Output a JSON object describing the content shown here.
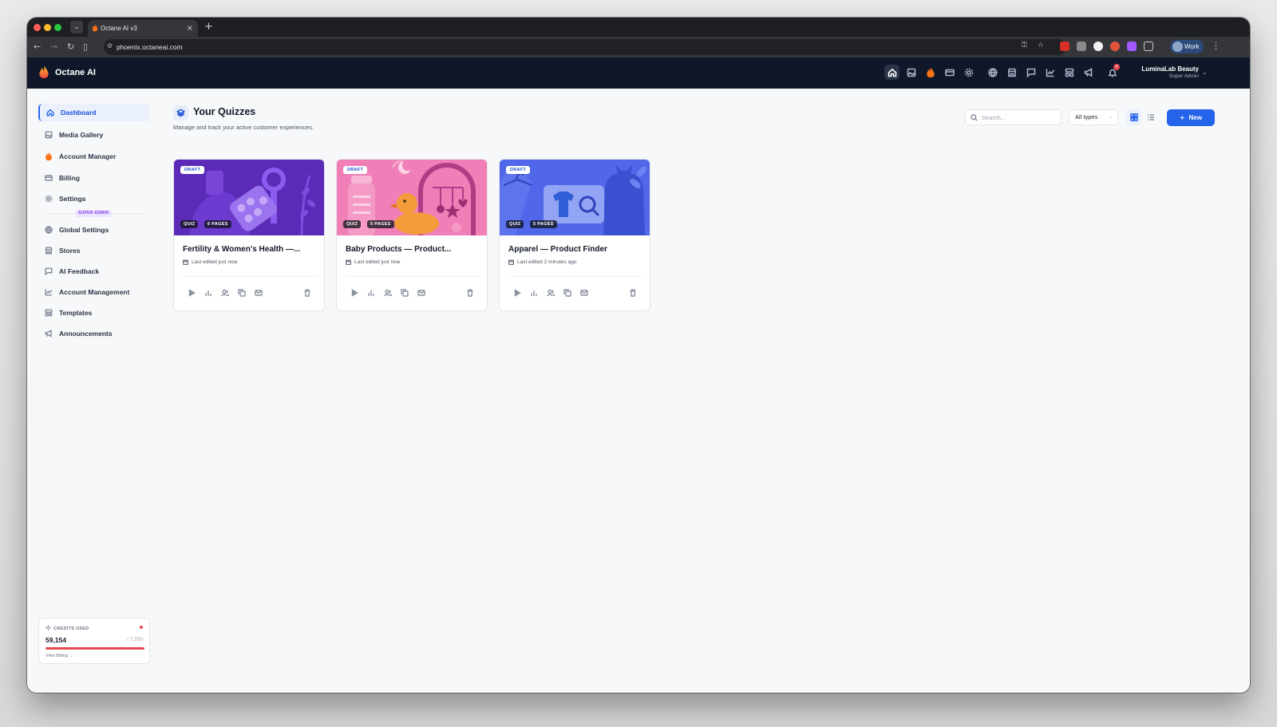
{
  "browser": {
    "tab_title": "Octane AI v3",
    "url": "phoenix.octaneai.com",
    "profile_label": "Work"
  },
  "app": {
    "brand": "Octane AI",
    "account_name": "LuminaLab Beauty",
    "account_role": "Super Admin",
    "notification_count": "4",
    "header_icons": [
      "home-icon",
      "image-icon",
      "flame-icon",
      "card-icon",
      "gear-icon",
      "globe-icon",
      "store-icon",
      "chat-icon",
      "chart-icon",
      "layout-icon",
      "megaphone-icon",
      "bell-icon"
    ]
  },
  "sidebar": {
    "items": [
      {
        "label": "Dashboard",
        "icon": "home-icon"
      },
      {
        "label": "Media Gallery",
        "icon": "image-icon"
      },
      {
        "label": "Account Manager",
        "icon": "flame-icon"
      },
      {
        "label": "Billing",
        "icon": "card-icon"
      },
      {
        "label": "Settings",
        "icon": "gear-icon"
      }
    ],
    "section_badge": "SUPER ADMIN",
    "admin_items": [
      {
        "label": "Global Settings",
        "icon": "globe-icon"
      },
      {
        "label": "Stores",
        "icon": "store-icon"
      },
      {
        "label": "AI Feedback",
        "icon": "chat-icon"
      },
      {
        "label": "Account Management",
        "icon": "chart-icon"
      },
      {
        "label": "Templates",
        "icon": "layout-icon"
      },
      {
        "label": "Announcements",
        "icon": "megaphone-icon"
      }
    ],
    "credits": {
      "label": "CREDITS USED",
      "value": "59,154",
      "max": "/ 7,250",
      "fill_fraction": 1.0,
      "link": "View Billing →"
    }
  },
  "main": {
    "title": "Your Quizzes",
    "subtitle": "Manage and track your active customer experiences.",
    "search_placeholder": "Search...",
    "type_filter": "All types",
    "new_button": "New",
    "cards": [
      {
        "status": "DRAFT",
        "type": "QUIZ",
        "pages": "6 PAGES",
        "title": "Fertility & Women's Health —...",
        "edited": "Last edited just now"
      },
      {
        "status": "DRAFT",
        "type": "QUIZ",
        "pages": "5 PAGES",
        "title": "Baby Products — Product...",
        "edited": "Last edited just now"
      },
      {
        "status": "DRAFT",
        "type": "QUIZ",
        "pages": "5 PAGES",
        "title": "Apparel — Product Finder",
        "edited": "Last edited 2 minutes ago"
      }
    ]
  },
  "colors": {
    "accent": "#2563eb",
    "header_bg": "#0f1729",
    "danger": "#e5484d",
    "card1_bg": "#5b2bb8",
    "card2_bg": "#f07fb8",
    "card3_bg": "#4f67e8"
  }
}
